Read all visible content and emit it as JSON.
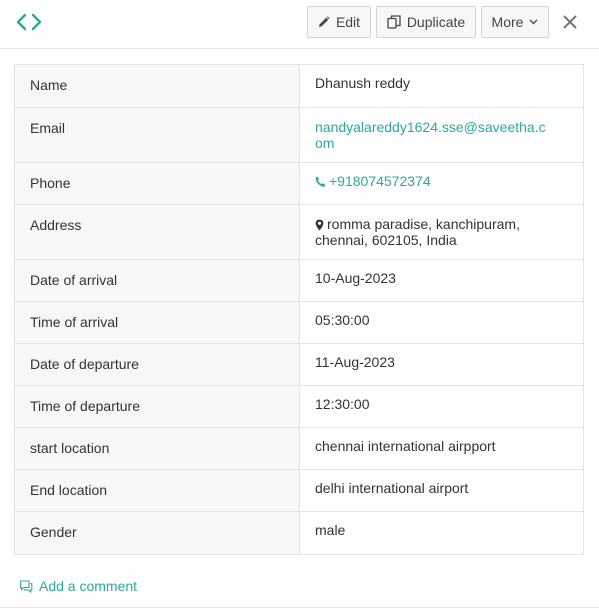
{
  "toolbar": {
    "edit_label": "Edit",
    "duplicate_label": "Duplicate",
    "more_label": "More"
  },
  "details": [
    {
      "label": "Name",
      "value": "Dhanush reddy",
      "type": "text"
    },
    {
      "label": "Email",
      "value": "nandyalareddy1624.sse@saveetha.com",
      "type": "email"
    },
    {
      "label": "Phone",
      "value": "+918074572374",
      "type": "phone"
    },
    {
      "label": "Address",
      "value": "romma paradise, kanchipuram, chennai, 602105, India",
      "type": "address"
    },
    {
      "label": "Date of arrival",
      "value": "10-Aug-2023",
      "type": "text"
    },
    {
      "label": "Time of arrival",
      "value": "05:30:00",
      "type": "text"
    },
    {
      "label": "Date of departure",
      "value": "11-Aug-2023",
      "type": "text"
    },
    {
      "label": "Time of departure",
      "value": "12:30:00",
      "type": "text"
    },
    {
      "label": "start location",
      "value": "chennai international airpport",
      "type": "text"
    },
    {
      "label": "End location",
      "value": "delhi international airport",
      "type": "text"
    },
    {
      "label": "Gender",
      "value": "male",
      "type": "text"
    }
  ],
  "comment": {
    "label": "Add a comment"
  },
  "colors": {
    "accent": "#2bab92",
    "label_bg": "#f7f7f7",
    "border": "#e3e3e3"
  },
  "icons": {
    "brand": "code-brackets-icon",
    "edit": "pencil-icon",
    "duplicate": "duplicate-icon",
    "more": "chevron-down-icon",
    "close": "close-icon",
    "phone": "phone-icon",
    "address": "map-marker-icon",
    "comment": "comment-icon"
  }
}
